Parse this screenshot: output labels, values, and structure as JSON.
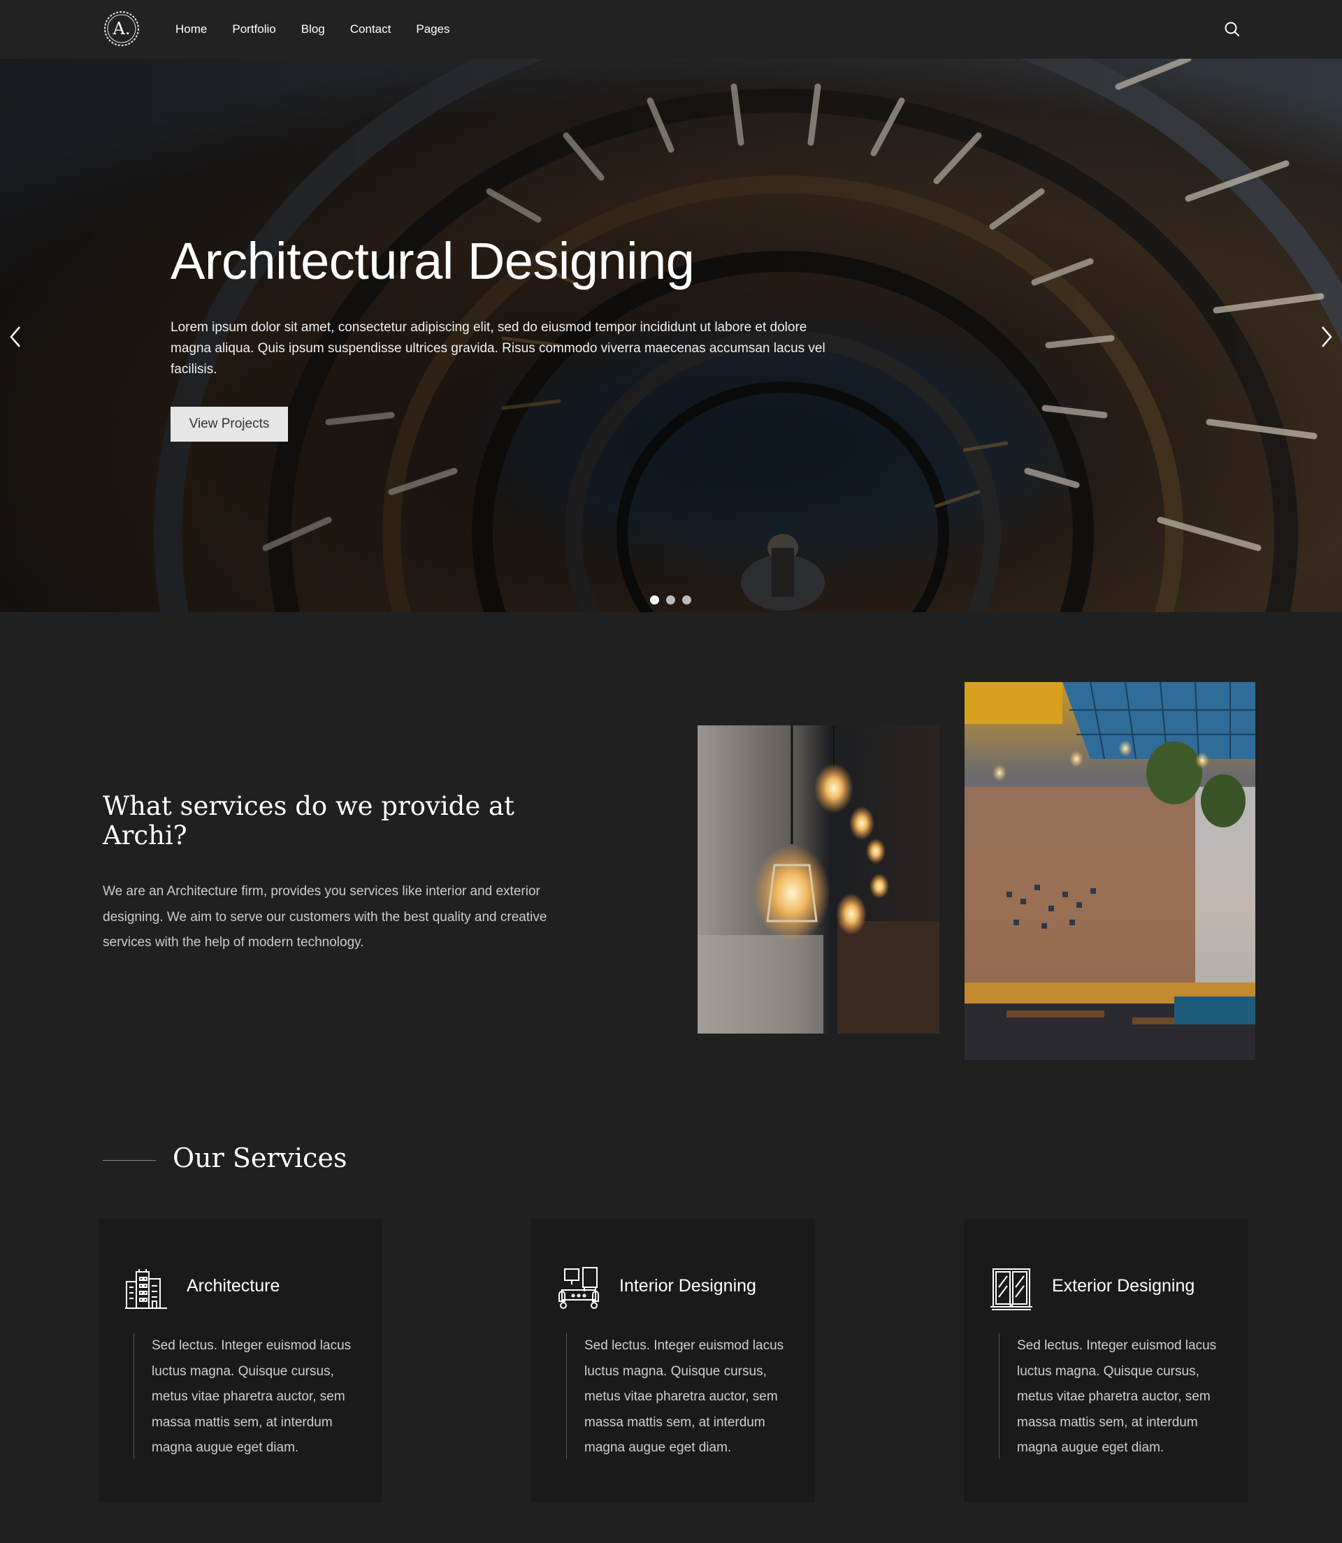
{
  "header": {
    "logo_text": "A.",
    "nav": [
      "Home",
      "Portfolio",
      "Blog",
      "Contact",
      "Pages"
    ],
    "search_icon": "search-icon"
  },
  "hero": {
    "title": "Architectural Designing",
    "text": "Lorem ipsum dolor sit amet, consectetur adipiscing elit, sed do eiusmod tempor incididunt ut labore et dolore magna aliqua. Quis ipsum suspendisse ultrices gravida. Risus commodo viverra maecenas accumsan lacus vel facilisis.",
    "button": "View Projects",
    "slides": 3,
    "active_slide": 1
  },
  "about": {
    "title": "What services do we provide at Archi?",
    "text": "We are an Architecture firm, provides you services like interior and exterior designing. We aim to serve our customers with the best quality and creative services with the help of modern technology."
  },
  "services": {
    "title": "Our Services",
    "items": [
      {
        "icon": "building-icon",
        "title": "Architecture",
        "text": "Sed lectus. Integer euismod lacus luctus magna. Quisque cursus, metus vitae pharetra auctor, sem massa mattis sem, at interdum magna augue eget diam."
      },
      {
        "icon": "sofa-icon",
        "title": "Interior Designing",
        "text": "Sed lectus. Integer euismod lacus luctus magna. Quisque cursus, metus vitae pharetra auctor, sem massa mattis sem, at interdum magna augue eget diam."
      },
      {
        "icon": "window-icon",
        "title": "Exterior Designing",
        "text": "Sed lectus. Integer euismod lacus luctus magna. Quisque cursus, metus vitae pharetra auctor, sem massa mattis sem, at interdum magna augue eget diam."
      }
    ]
  },
  "colors": {
    "background": "#202020",
    "header": "#222222",
    "card": "#1a1a1a",
    "button": "#e6e6e6"
  }
}
